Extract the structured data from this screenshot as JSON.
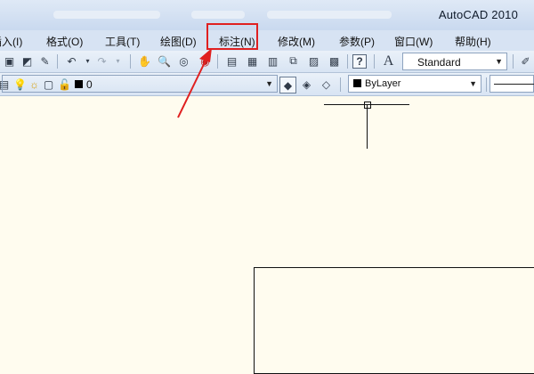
{
  "window": {
    "app_title": "AutoCAD 2010"
  },
  "menubar": {
    "items": [
      {
        "label": "插入(I)"
      },
      {
        "label": "格式(O)"
      },
      {
        "label": "工具(T)"
      },
      {
        "label": "绘图(D)"
      },
      {
        "label": "标注(N)"
      },
      {
        "label": "修改(M)"
      },
      {
        "label": "参数(P)"
      },
      {
        "label": "窗口(W)"
      },
      {
        "label": "帮助(H)"
      }
    ]
  },
  "toolbar": {
    "text_style": "Standard",
    "layer": "0",
    "color": "ByLayer"
  },
  "annotation": {
    "highlight_color": "#e02020"
  },
  "icons": {
    "text_style_icon": "A",
    "help_icon": "?"
  }
}
